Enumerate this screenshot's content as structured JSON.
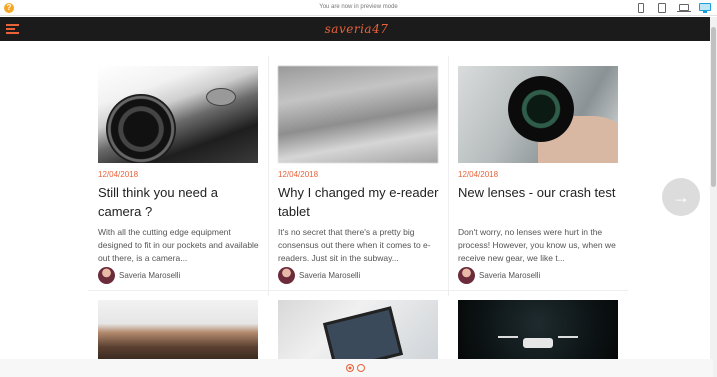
{
  "preview_bar": {
    "message": "You are now in preview mode",
    "help_icon": "?",
    "devices": [
      {
        "name": "phone-icon"
      },
      {
        "name": "tablet-icon"
      },
      {
        "name": "laptop-icon"
      },
      {
        "name": "desktop-icon",
        "active": true
      }
    ]
  },
  "site": {
    "logo": "saveria47",
    "accent_color": "#e8623a"
  },
  "posts": [
    {
      "date": "12/04/2018",
      "title": "Still think you need a camera ?",
      "excerpt": "With all the cutting edge equipment designed to fit in our pockets and available out there, is a camera...",
      "author": "Saveria Maroselli",
      "image": "camera-closeup"
    },
    {
      "date": "12/04/2018",
      "title": "Why I changed my e-reader tablet",
      "excerpt": "It's no secret that there's a pretty big consensus out there when it comes to e-readers. Just sit in the subway...",
      "author": "Saveria Maroselli",
      "image": "blurred-surface"
    },
    {
      "date": "12/04/2018",
      "title": "New lenses - our crash test",
      "excerpt": "Don't worry, no lenses were hurt in the process! However, you know us, when we receive new gear, we like t...",
      "author": "Saveria Maroselli",
      "image": "lens-in-hand"
    }
  ],
  "next_row_images": [
    "car",
    "tablet-hands",
    "drone"
  ],
  "next_button": {
    "icon": "arrow-right-icon",
    "glyph": "→"
  },
  "pagination": {
    "pages": 2,
    "current": 1
  }
}
